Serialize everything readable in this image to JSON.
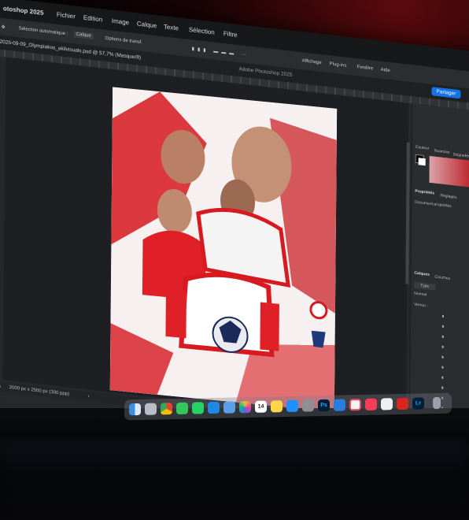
{
  "menubar": {
    "app": "otoshop 2025",
    "items": [
      "Fichier",
      "Edition",
      "Image",
      "Calque",
      "Texte",
      "Sélection",
      "Filtre"
    ]
  },
  "options_bar": {
    "auto_select": "Sélection automatique :",
    "layer_value": "Calque",
    "transform_options": "Options de transf."
  },
  "tab": {
    "filename": "2025-09-09_Olympiakos_akilvisuals.psd @ 57,7% (Masque/8)",
    "app_title": "Adobe Photoshop 2025"
  },
  "top_right": {
    "workspace_items": [
      "Affichage",
      "Plug-ins",
      "Fenêtre",
      "Aide"
    ],
    "share_button": "Partager"
  },
  "right_panel": {
    "tabs_top": [
      "Couleur",
      "Nuancier",
      "Dégradés"
    ],
    "properties_tabs": [
      "Propriétés",
      "Réglages"
    ],
    "properties_subtitle": "Document propriétés",
    "layers_tabs": [
      "Calques",
      "Couches"
    ],
    "layers_filter": "Type",
    "blend_mode": "Normal",
    "lock_label": "Verrou :"
  },
  "status": {
    "doc_size": "2000 px x 2500 px (300 ppp)"
  },
  "dock": {
    "apps": [
      "Finder",
      "Launchpad",
      "Chrome",
      "Messages",
      "WhatsApp",
      "Mail",
      "Photos",
      "Photos",
      "Calendar",
      "Notes",
      "App Store",
      "Settings",
      "Photoshop",
      "Safari",
      "Music",
      "Pages",
      "Acrobat",
      "Lightroom",
      "Preview",
      "Downloads",
      "Trash"
    ],
    "calendar_day": "14",
    "ps_label": "Ps",
    "lr_label": "Lr"
  },
  "colors": {
    "menubar_bg": "#17181a",
    "canvas_bg": "#1e1f22",
    "accent_red": "#d71920",
    "share_blue": "#1473e6"
  }
}
